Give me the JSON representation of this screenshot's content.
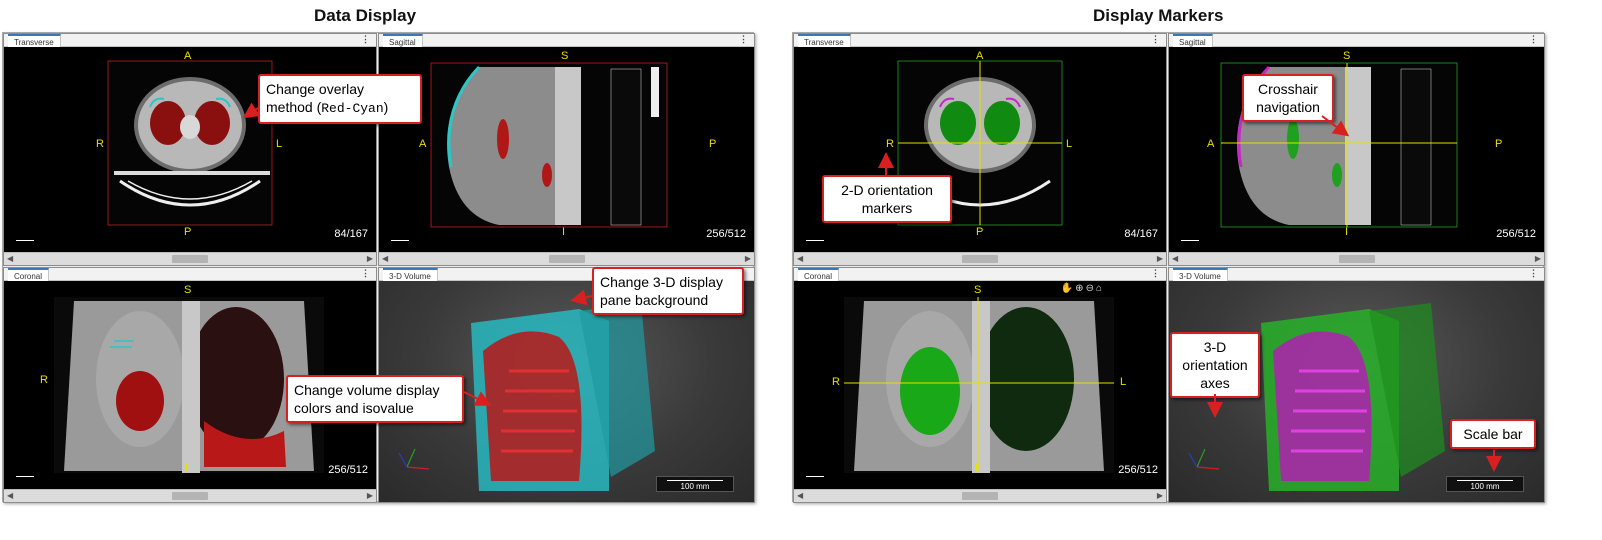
{
  "sections": {
    "left_title": "Data Display",
    "right_title": "Display Markers"
  },
  "tabs": {
    "transverse": "Transverse",
    "sagittal": "Sagittal",
    "coronal": "Coronal",
    "volume": "3-D Volume",
    "menu": "⋮"
  },
  "orientation": {
    "anterior": "A",
    "posterior": "P",
    "right": "R",
    "left": "L",
    "superior": "S",
    "inferior": "I"
  },
  "slices": {
    "transverse": "84/167",
    "sagittal": "256/512",
    "coronal": "256/512"
  },
  "scale_bar_label": "100 mm",
  "callouts": {
    "overlay_method_line1": "Change overlay",
    "overlay_method_line2": "method (",
    "overlay_method_code": "Red-Cyan",
    "overlay_method_close": ")",
    "pane_background_line1": "Change 3-D display",
    "pane_background_line2": "pane background",
    "volume_colors_line1": "Change volume display",
    "volume_colors_line2": "colors and isovalue",
    "orientation_markers_line1": "2-D orientation",
    "orientation_markers_line2": "markers",
    "crosshair_line1": "Crosshair",
    "crosshair_line2": "navigation",
    "orientation_axes_line1": "3-D",
    "orientation_axes_line2": "orientation",
    "orientation_axes_line3": "axes",
    "scale_bar": "Scale bar"
  },
  "toolbar_icons": [
    "pan-icon",
    "zoom-in-icon",
    "zoom-out-icon",
    "home-icon"
  ],
  "colors": {
    "overlay_red": "#c81818",
    "overlay_cyan": "#28c8c8",
    "overlay_magenta": "#c828c8",
    "overlay_green": "#20c020",
    "marker_yellow": "#e8e000",
    "callout_border": "#d92020",
    "tab_accent": "#3c78b4"
  }
}
